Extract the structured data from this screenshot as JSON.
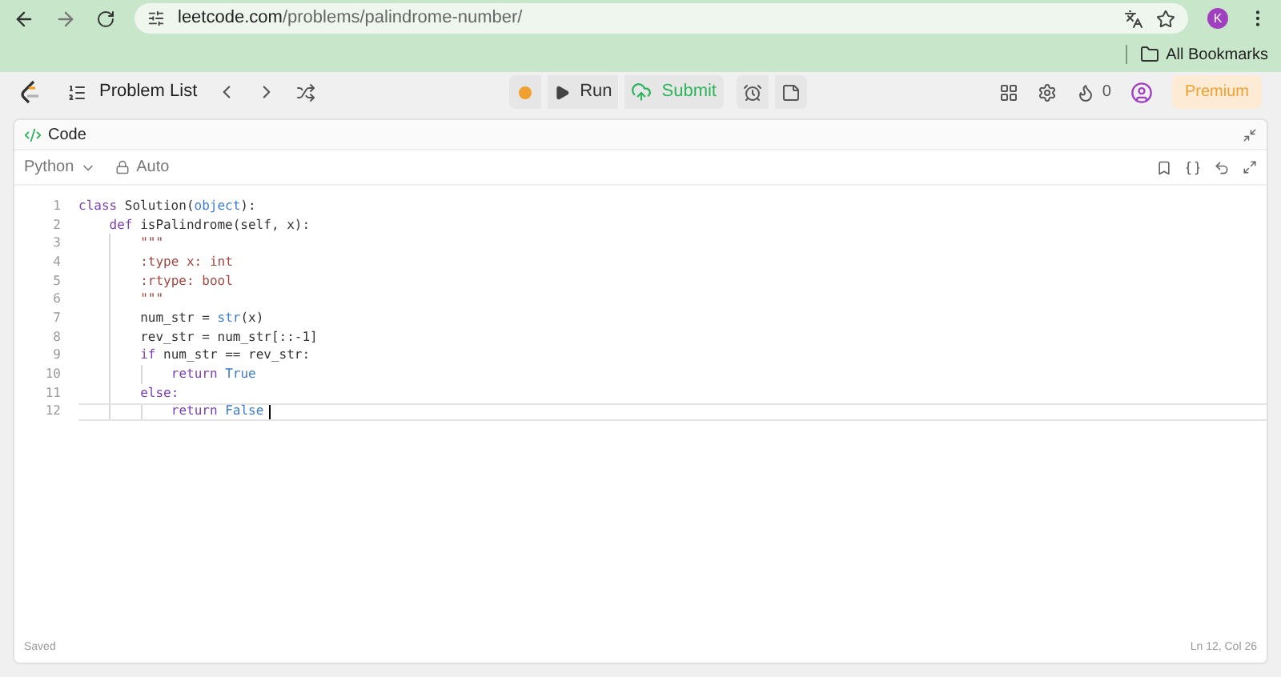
{
  "browser": {
    "url_host": "leetcode.com",
    "url_path": "/problems/palindrome-number/",
    "profile_initial": "K",
    "bookmarks": "All Bookmarks"
  },
  "nav": {
    "problem_list": "Problem List",
    "run": "Run",
    "submit": "Submit",
    "streak": "0",
    "premium": "Premium"
  },
  "panel": {
    "title": "Code",
    "language": "Python",
    "mode": "Auto"
  },
  "code": [
    {
      "number": "1",
      "current": false,
      "tokens": [
        {
          "kind": "keyword",
          "text": "class "
        },
        {
          "kind": "plain",
          "text": "Solution("
        },
        {
          "kind": "builtin",
          "text": "object"
        },
        {
          "kind": "plain",
          "text": "):"
        }
      ],
      "children": [
        {
          "number": "2",
          "current": false,
          "tokens": [
            {
              "kind": "keyword",
              "text": "def "
            },
            {
              "kind": "plain",
              "text": "isPalindrome(self, x):"
            }
          ],
          "children": [
            {
              "number": "3",
              "current": false,
              "tokens": [
                {
                  "kind": "string",
                  "text": "\"\"\""
                }
              ]
            },
            {
              "number": "4",
              "current": false,
              "tokens": [
                {
                  "kind": "string",
                  "text": ":type x: int"
                }
              ]
            },
            {
              "number": "5",
              "current": false,
              "tokens": [
                {
                  "kind": "string",
                  "text": ":rtype: bool"
                }
              ]
            },
            {
              "number": "6",
              "current": false,
              "tokens": [
                {
                  "kind": "string",
                  "text": "\"\"\""
                }
              ]
            },
            {
              "number": "7",
              "current": false,
              "tokens": [
                {
                  "kind": "plain",
                  "text": "num_str = "
                },
                {
                  "kind": "builtin",
                  "text": "str"
                },
                {
                  "kind": "plain",
                  "text": "(x)"
                }
              ]
            },
            {
              "number": "8",
              "current": false,
              "tokens": [
                {
                  "kind": "plain",
                  "text": "rev_str = num_str[::-1]"
                }
              ]
            },
            {
              "number": "9",
              "current": false,
              "tokens": [
                {
                  "kind": "keyword",
                  "text": "if "
                },
                {
                  "kind": "plain",
                  "text": "num_str == rev_str:"
                }
              ],
              "children": [
                {
                  "number": "10",
                  "current": false,
                  "tokens": [
                    {
                      "kind": "keyword",
                      "text": "return "
                    },
                    {
                      "kind": "builtin",
                      "text": "True"
                    }
                  ]
                }
              ]
            },
            {
              "number": "11",
              "current": false,
              "tokens": [
                {
                  "kind": "keyword",
                  "text": "else:"
                }
              ],
              "children": [
                {
                  "number": "12",
                  "current": true,
                  "tokens": [
                    {
                      "kind": "keyword",
                      "text": "return "
                    },
                    {
                      "kind": "builtin",
                      "text": "False"
                    }
                  ]
                }
              ]
            }
          ]
        }
      ]
    }
  ],
  "status": {
    "saved": "Saved",
    "position": "Ln 12, Col 26"
  }
}
